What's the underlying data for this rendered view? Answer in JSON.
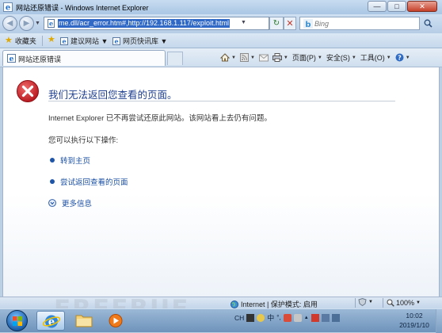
{
  "window": {
    "title": "网站还原错误 - Windows Internet Explorer"
  },
  "address_bar": {
    "url": "me.dll/acr_error.htm#,http://192.168.1.117/exploit.html",
    "search_placeholder": "Bing"
  },
  "favorites_bar": {
    "favorites_label": "收藏夹",
    "items": [
      {
        "label": "建议网站 ▼"
      },
      {
        "label": "网页快讯库 ▼"
      }
    ]
  },
  "tab": {
    "label": "网站还原错误"
  },
  "command_bar": {
    "page_label": "页面(P)",
    "safety_label": "安全(S)",
    "tools_label": "工具(O)"
  },
  "content": {
    "title": "我们无法返回您查看的页面。",
    "description": "Internet Explorer 已不再尝试还原此网站。该网站看上去仍有问题。",
    "subheading": "您可以执行以下操作:",
    "options": [
      {
        "label": "转到主页"
      },
      {
        "label": "尝试返回查看的页面"
      }
    ],
    "more_info": "更多信息"
  },
  "status_bar": {
    "zone": "Internet | 保护模式: 启用",
    "zoom": "100%"
  },
  "taskbar": {
    "tray_lang": "CH",
    "tray_ime": "中",
    "time": "10:02",
    "date": "2019/1/10"
  },
  "watermark": {
    "text": "FREEBUF"
  },
  "colors": {
    "accent": "#1f55a9",
    "error_red": "#c0232b",
    "link": "#1a4fa3"
  }
}
